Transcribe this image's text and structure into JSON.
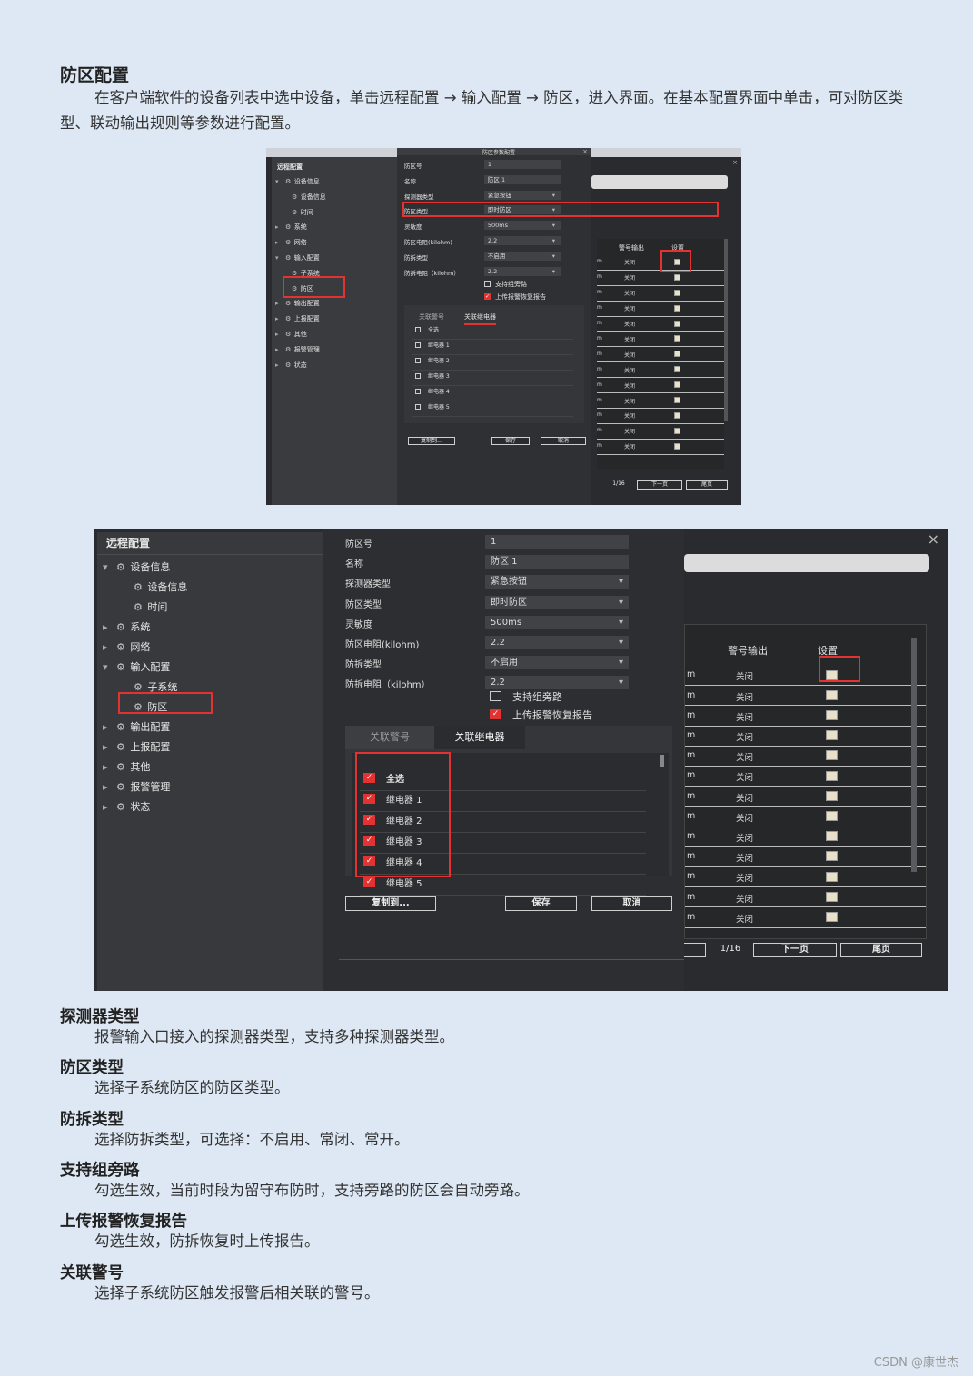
{
  "heading": "防区配置",
  "intro": "在客户端软件的设备列表中选中设备，单击远程配置 → 输入配置 → 防区，进入界面。在基本配置界面中单击，可对防区类型、联动输出规则等参数进行配置。",
  "fig1": {
    "title": "远程配置",
    "dialog_title": "防区参数配置",
    "tree": [
      "设备信息",
      "设备信息",
      "时间",
      "系统",
      "网络",
      "输入配置",
      "子系统",
      "防区",
      "输出配置",
      "上报配置",
      "其他",
      "报警管理",
      "状态"
    ],
    "fields": [
      {
        "label": "防区号",
        "value": "1"
      },
      {
        "label": "名称",
        "value": "防区 1"
      },
      {
        "label": "探测器类型",
        "value": "紧急按钮"
      },
      {
        "label": "防区类型",
        "value": "即时防区"
      },
      {
        "label": "灵敏度",
        "value": "500ms"
      },
      {
        "label": "防区电阻(kilohm)",
        "value": "2.2"
      },
      {
        "label": "防拆类型",
        "value": "不启用"
      },
      {
        "label": "防拆电阻（kilohm）",
        "value": "2.2"
      }
    ],
    "opt1": "支持组旁路",
    "opt2": "上传报警恢复报告",
    "tab1": "关联警号",
    "tab2": "关联继电器",
    "relays": [
      "全选",
      "继电器 1",
      "继电器 2",
      "继电器 3",
      "继电器 4",
      "继电器 5"
    ],
    "btn_copy": "复制到...",
    "btn_save": "保存",
    "btn_cancel": "取消",
    "col_out": "警号输出",
    "col_set": "设置",
    "row_prefix": "m",
    "row_val": "关闭",
    "page": "1/16",
    "next": "下一页",
    "last": "尾页"
  },
  "fig2": {
    "title": "远程配置",
    "tree": [
      "设备信息",
      "设备信息",
      "时间",
      "系统",
      "网络",
      "输入配置",
      "子系统",
      "防区",
      "输出配置",
      "上报配置",
      "其他",
      "报警管理",
      "状态"
    ],
    "fields": [
      {
        "label": "防区号",
        "value": "1"
      },
      {
        "label": "名称",
        "value": "防区 1"
      },
      {
        "label": "探测器类型",
        "value": "紧急按钮"
      },
      {
        "label": "防区类型",
        "value": "即时防区"
      },
      {
        "label": "灵敏度",
        "value": "500ms"
      },
      {
        "label": "防区电阻(kilohm)",
        "value": "2.2"
      },
      {
        "label": "防拆类型",
        "value": "不启用"
      },
      {
        "label": "防拆电阻（kilohm）",
        "value": "2.2"
      }
    ],
    "opt1": "支持组旁路",
    "opt2": "上传报警恢复报告",
    "tab1": "关联警号",
    "tab2": "关联继电器",
    "relays": [
      "全选",
      "继电器 1",
      "继电器 2",
      "继电器 3",
      "继电器 4",
      "继电器 5"
    ],
    "btn_copy": "复制到...",
    "btn_save": "保存",
    "btn_cancel": "取消",
    "col_out": "警号输出",
    "col_set": "设置",
    "row_prefix": "m",
    "row_val": "关闭",
    "page": "1/16",
    "next": "下一页",
    "last": "尾页"
  },
  "sections": [
    {
      "title": "探测器类型",
      "text": "报警输入口接入的探测器类型，支持多种探测器类型。"
    },
    {
      "title": "防区类型",
      "text": "选择子系统防区的防区类型。"
    },
    {
      "title": "防拆类型",
      "text": "选择防拆类型，可选择：不启用、常闭、常开。"
    },
    {
      "title": "支持组旁路",
      "text": "勾选生效，当前时段为留守布防时，支持旁路的防区会自动旁路。"
    },
    {
      "title": "上传报警恢复报告",
      "text": "勾选生效，防拆恢复时上传报告。"
    },
    {
      "title": "关联警号",
      "text": "选择子系统防区触发报警后相关联的警号。"
    }
  ],
  "watermark": "CSDN @康世杰"
}
